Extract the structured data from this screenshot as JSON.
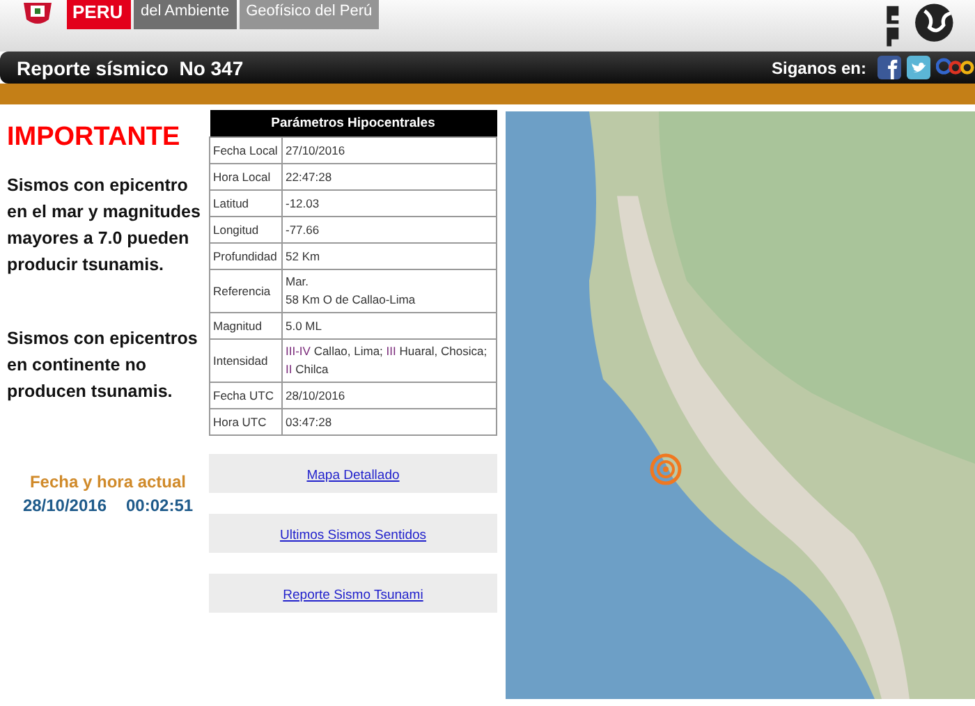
{
  "header": {
    "flag_label": "PERU",
    "ministry": "del Ambiente",
    "institute": "Geofísico del Perú"
  },
  "title_bar": {
    "title": "Reporte sísmico  No 347",
    "follow_label": "Siganos en:"
  },
  "notice": {
    "heading": "IMPORTANTE",
    "paragraphs": [
      "Sismos con epicentro en el mar y magnitudes mayores a 7.0 pueden producir tsunamis.",
      "Sismos con epicentros en continente no producen tsunamis."
    ]
  },
  "clock": {
    "label": "Fecha y hora actual",
    "date": "28/10/2016",
    "time": "00:02:51"
  },
  "table": {
    "title": "Parámetros Hipocentrales",
    "rows": [
      {
        "label": "Fecha Local",
        "parts": [
          {
            "kind": "plain",
            "text": "27/10/2016"
          }
        ]
      },
      {
        "label": "Hora Local",
        "parts": [
          {
            "kind": "plain",
            "text": "22:47:28"
          }
        ]
      },
      {
        "label": "Latitud",
        "parts": [
          {
            "kind": "plain",
            "text": "-12.03"
          }
        ]
      },
      {
        "label": "Longitud",
        "parts": [
          {
            "kind": "plain",
            "text": "-77.66"
          }
        ]
      },
      {
        "label": "Profundidad",
        "parts": [
          {
            "kind": "plain",
            "text": "52 Km"
          }
        ]
      },
      {
        "label": "Referencia",
        "parts": [
          {
            "kind": "plain",
            "text": "Mar."
          },
          {
            "kind": "break"
          },
          {
            "kind": "plain",
            "text": "58 Km O de Callao-Lima"
          }
        ]
      },
      {
        "label": "Magnitud",
        "parts": [
          {
            "kind": "plain",
            "text": "5.0 ML"
          }
        ]
      },
      {
        "label": "Intensidad",
        "parts": [
          {
            "kind": "grade",
            "text": "III-IV"
          },
          {
            "kind": "plain",
            "text": " Callao, Lima; "
          },
          {
            "kind": "grade",
            "text": "III"
          },
          {
            "kind": "plain",
            "text": " Huaral, Chosica; "
          },
          {
            "kind": "grade",
            "text": "II"
          },
          {
            "kind": "plain",
            "text": " Chilca"
          }
        ]
      },
      {
        "label": "Fecha UTC",
        "parts": [
          {
            "kind": "plain",
            "text": "28/10/2016"
          }
        ]
      },
      {
        "label": "Hora UTC",
        "parts": [
          {
            "kind": "plain",
            "text": "03:47:28"
          }
        ]
      }
    ]
  },
  "links": [
    "Mapa Detallado",
    "Ultimos Sismos Sentidos",
    "Reporte Sismo Tsunami"
  ]
}
